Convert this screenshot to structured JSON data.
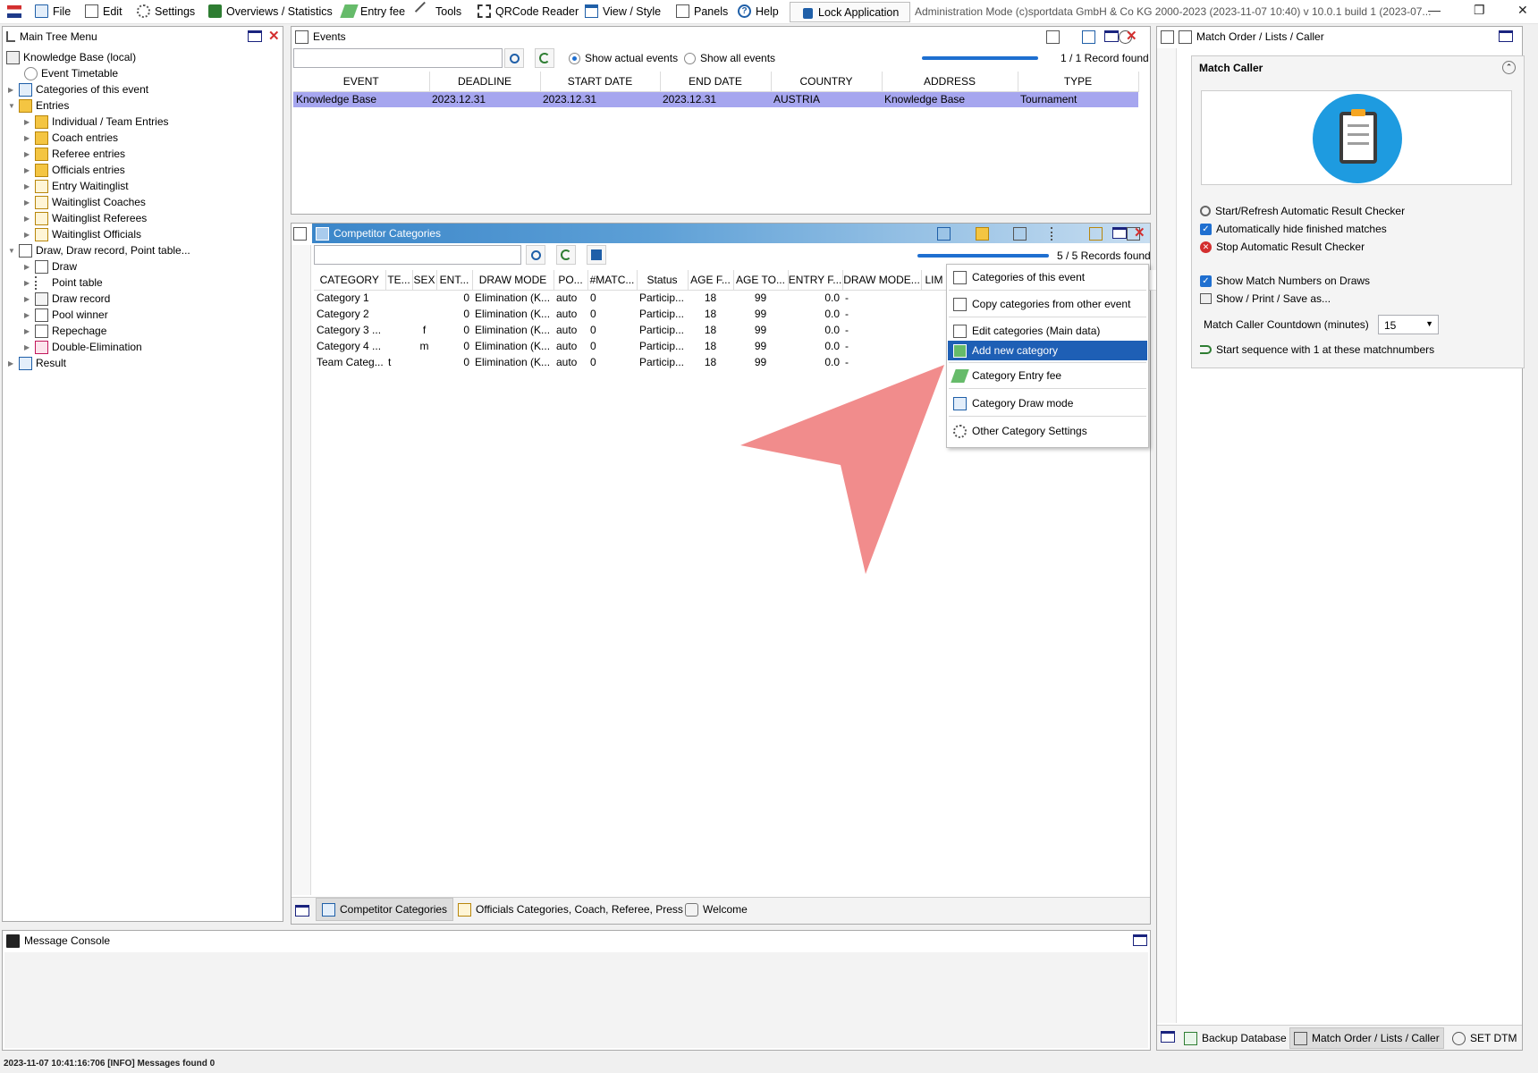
{
  "menubar": {
    "items": [
      "File",
      "Edit",
      "Settings",
      "Overviews / Statistics",
      "Entry fee",
      "Tools",
      "QRCode Reader",
      "View / Style",
      "Panels",
      "Help"
    ],
    "lock_label": "Lock Application",
    "admin_text": "Administration Mode (c)sportdata GmbH & Co KG 2000-2023 (2023-11-07 10:40)  v 10.0.1 build 1 (2023-07..."
  },
  "tree_panel": {
    "title": "Main Tree Menu",
    "items": [
      "Knowledge Base (local)",
      "Event Timetable",
      "Categories of this event",
      "Entries",
      "Individual / Team Entries",
      "Coach entries",
      "Referee entries",
      "Officials entries",
      "Entry Waitinglist",
      "Waitinglist Coaches",
      "Waitinglist Referees",
      "Waitinglist Officials",
      "Draw, Draw record, Point table...",
      "Draw",
      "Point table",
      "Draw record",
      "Pool winner",
      "Repechage",
      "Double-Elimination",
      "Result"
    ]
  },
  "events_panel": {
    "title": "Events",
    "radio_actual": "Show actual events",
    "radio_all": "Show all events",
    "records": "1 / 1 Record found",
    "columns": [
      "EVENT",
      "DEADLINE",
      "START DATE",
      "END DATE",
      "COUNTRY",
      "ADDRESS",
      "TYPE"
    ],
    "rows": [
      [
        "Knowledge Base",
        "2023.12.31",
        "2023.12.31",
        "2023.12.31",
        "AUSTRIA",
        "Knowledge Base",
        "Tournament"
      ]
    ]
  },
  "categories_panel": {
    "title": "Competitor Categories",
    "records": "5 / 5 Records found",
    "columns": [
      "CATEGORY",
      "TE...",
      "SEX",
      "ENT...",
      "DRAW MODE",
      "PO...",
      "#MATC...",
      "Status",
      "AGE F...",
      "AGE TO...",
      "ENTRY F...",
      "DRAW MODE...",
      "LIM"
    ],
    "rows": [
      [
        "Category 1",
        "",
        "",
        "0",
        "Elimination (K...",
        "auto",
        "0",
        "Particip...",
        "18",
        "99",
        "0.0",
        "-",
        ""
      ],
      [
        "Category 2",
        "",
        "",
        "0",
        "Elimination (K...",
        "auto",
        "0",
        "Particip...",
        "18",
        "99",
        "0.0",
        "-",
        ""
      ],
      [
        "Category 3 ...",
        "",
        "f",
        "0",
        "Elimination (K...",
        "auto",
        "0",
        "Particip...",
        "18",
        "99",
        "0.0",
        "-",
        ""
      ],
      [
        "Category 4 ...",
        "",
        "m",
        "0",
        "Elimination (K...",
        "auto",
        "0",
        "Particip...",
        "18",
        "99",
        "0.0",
        "-",
        ""
      ],
      [
        "Team Categ...",
        "t",
        "",
        "0",
        "Elimination (K...",
        "auto",
        "0",
        "Particip...",
        "18",
        "99",
        "0.0",
        "-",
        ""
      ]
    ],
    "tabs": [
      "Competitor Categories",
      "Officials Categories, Coach, Referee, Press",
      "Welcome"
    ]
  },
  "context_menu": {
    "items": [
      "Categories of this event",
      "Copy categories from other event",
      "Edit categories (Main data)",
      "Add new category",
      "Category Entry fee",
      "Category Draw mode",
      "Other Category Settings"
    ],
    "highlighted": "Add new category"
  },
  "console": {
    "title": "Message Console"
  },
  "right_panel": {
    "title": "Match Order / Lists / Caller",
    "section_title": "Match Caller",
    "items": [
      "Start/Refresh Automatic Result Checker",
      "Automatically hide finished matches",
      "Stop Automatic Result Checker",
      "Show Match Numbers on Draws",
      "Show / Print / Save as..."
    ],
    "countdown_label": "Match Caller Countdown (minutes)",
    "countdown_value": "15",
    "start_label": "Start sequence with 1 at these matchnumbers",
    "tabs": [
      "Backup Database",
      "Match Order / Lists / Caller",
      "SET DTM"
    ]
  },
  "statusbar": {
    "text": "2023-11-07 10:41:16:706 [INFO] Messages found 0"
  },
  "colors": {
    "selection": "#a6a6ef",
    "menu_highlight": "#1e5fb5",
    "title_gradient": "#3b86c9",
    "arrow": "#f08080"
  }
}
